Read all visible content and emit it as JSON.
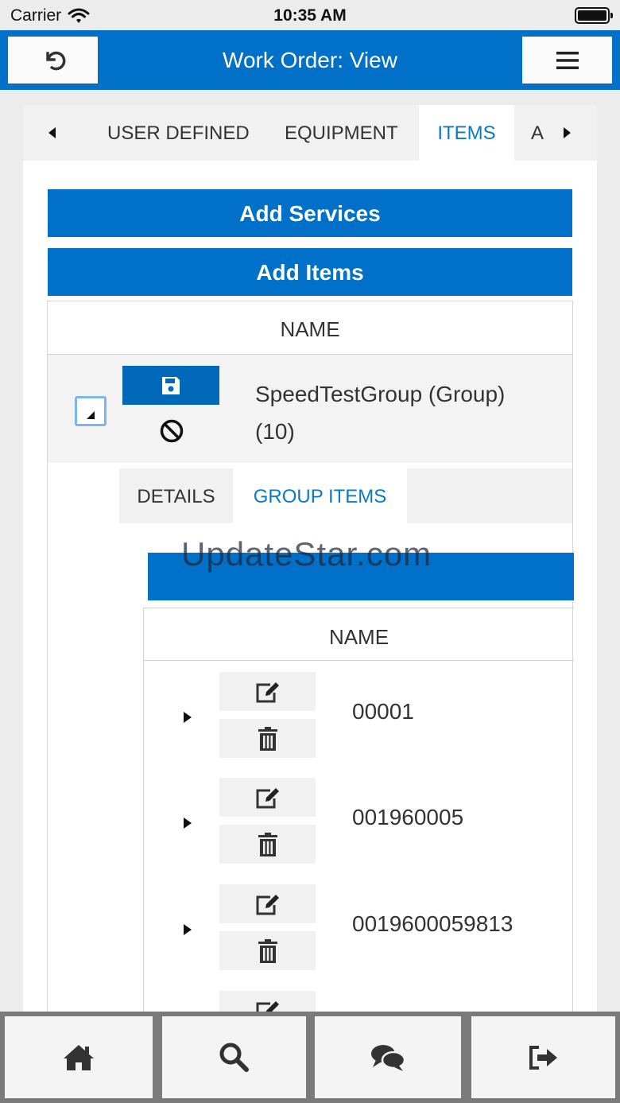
{
  "status_bar": {
    "carrier": "Carrier",
    "time": "10:35 AM"
  },
  "header": {
    "title": "Work Order: View",
    "back_icon": "undo-icon",
    "menu_icon": "hamburger-icon"
  },
  "tabs": [
    {
      "label": "USER DEFINED",
      "active": false
    },
    {
      "label": "EQUIPMENT",
      "active": false
    },
    {
      "label": "ITEMS",
      "active": true
    },
    {
      "label": "A",
      "active": false
    }
  ],
  "buttons": {
    "add_services": "Add Services",
    "add_items": "Add Items"
  },
  "grid": {
    "column_header": "NAME",
    "group": {
      "name_line1": "SpeedTestGroup (Group)",
      "name_line2": "(10)"
    }
  },
  "subtabs": [
    {
      "label": "DETAILS",
      "active": false
    },
    {
      "label": "GROUP ITEMS",
      "active": true
    }
  ],
  "watermark": "UpdateStar.com",
  "subgrid": {
    "column_header": "NAME",
    "rows": [
      {
        "name": "00001"
      },
      {
        "name": "001960005"
      },
      {
        "name": "0019600059813"
      },
      {
        "name": ""
      }
    ]
  },
  "bottom_nav": [
    {
      "icon": "home-icon"
    },
    {
      "icon": "search-icon"
    },
    {
      "icon": "chat-icon"
    },
    {
      "icon": "logout-icon"
    }
  ],
  "colors": {
    "primary": "#0070c8",
    "active_tab_text": "#0a7ac6",
    "save_button": "#0068b8"
  }
}
